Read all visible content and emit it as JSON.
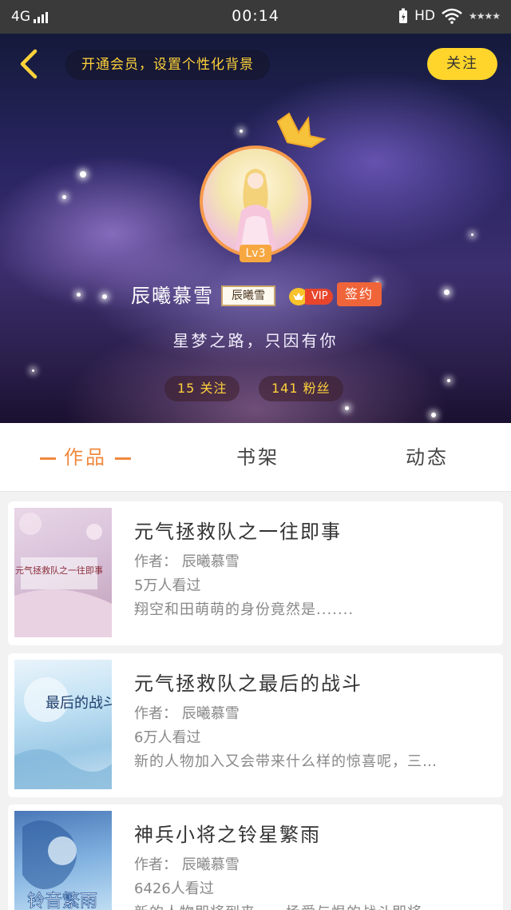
{
  "status_bar": {
    "network": "4G",
    "time": "00:14",
    "hd": "HD",
    "stars": "★★★★"
  },
  "header": {
    "vip_banner": "开通会员，设置个性化背景",
    "follow_label": "关注",
    "level": "Lv3",
    "username": "辰曦慕雪",
    "name_tag": "辰曦雪",
    "vip_label": "VIP",
    "signed_label": "签约",
    "motto": "星梦之路，只因有你",
    "following": "15 关注",
    "fans": "141 粉丝"
  },
  "tabs": {
    "works": "作品",
    "shelf": "书架",
    "feed": "动态"
  },
  "books": [
    {
      "title": "元气拯救队之一往即事",
      "author": "作者：  辰曦慕雪",
      "views": "5万人看过",
      "desc": "翔空和田萌萌的身份竟然是.......",
      "cover_text": "元气拯救队之一往即事"
    },
    {
      "title": "元气拯救队之最后的战斗",
      "author": "作者：  辰曦慕雪",
      "views": "6万人看过",
      "desc": "新的人物加入又会带来什么样的惊喜呢，三…",
      "cover_text": "最后的战斗"
    },
    {
      "title": "神兵小将之铃星繁雨",
      "author": "作者：  辰曦慕雪",
      "views": "6426人看过",
      "desc": "新的人物即将到来，一场爱与恨的战斗即将…",
      "cover_text": "铃音繁雨"
    }
  ],
  "colors": {
    "accent": "#f0883e",
    "follow_button": "#ffd52b",
    "signed_badge": "#f0643a",
    "vip_red": "#e8452c"
  }
}
